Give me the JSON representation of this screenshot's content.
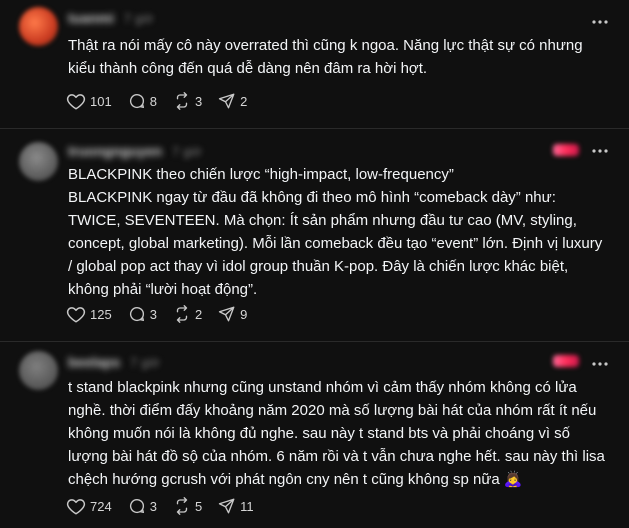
{
  "posts": [
    {
      "username": "tuanmi",
      "timestamp": "7 giờ",
      "text": "Thật ra nói mấy cô này overrated thì cũng k ngoa. Năng lực thật sự có nhưng kiểu thành công đến quá dễ dàng nên đâm ra hời hợt.",
      "likes": "101",
      "replies": "8",
      "reposts": "3",
      "shares": "2"
    },
    {
      "username": "truongnguyen",
      "timestamp": "7 giờ",
      "text": "BLACKPINK theo chiến lược “high-impact, low-frequency”\nBLACKPINK ngay từ đầu đã không đi theo mô hình “comeback dày” như: TWICE, SEVENTEEN. Mà chọn: Ít sản phẩm nhưng đầu tư cao (MV, styling, concept, global marketing). Mỗi lần comeback đều tạo “event” lớn. Định vị luxury / global pop act thay vì idol group thuần K-pop. Đây là chiến lược khác biệt, không phải “lười hoạt động”.",
      "likes": "125",
      "replies": "3",
      "reposts": "2",
      "shares": "9"
    },
    {
      "username": "beelaps",
      "timestamp": "7 giờ",
      "text": "t stand blackpink nhưng cũng unstand nhóm vì cảm thấy nhóm không có lửa nghề. thời điểm đấy khoảng năm 2020 mà số lượng bài hát của nhóm rất ít nếu không muốn nói là không đủ nghe. sau này t stand bts và phải choáng vì số lượng bài hát đồ sộ của nhóm. 6 năm rồi và t vẫn chưa nghe hết. sau này thì lisa chệch hướng gcrush với phát ngôn cny nên t cũng không sp nữa 🙇‍♀️",
      "likes": "724",
      "replies": "3",
      "reposts": "5",
      "shares": "11"
    }
  ],
  "colors": {
    "background": "#101010",
    "text": "#f3f5f7",
    "icon": "#c8c8c8",
    "divider": "#2a2a2a"
  }
}
